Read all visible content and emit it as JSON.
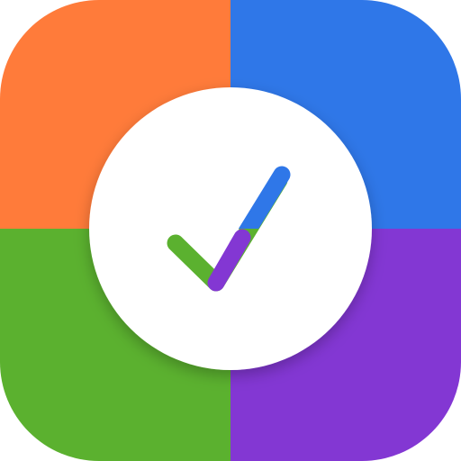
{
  "icon": {
    "name": "checkmark-app-icon",
    "colors": {
      "orange": "#FF7B3A",
      "blue": "#2F77E8",
      "green": "#5BB12F",
      "purple": "#8337D3",
      "circle": "#FFFFFF"
    },
    "glyph": "checkmark-icon"
  }
}
